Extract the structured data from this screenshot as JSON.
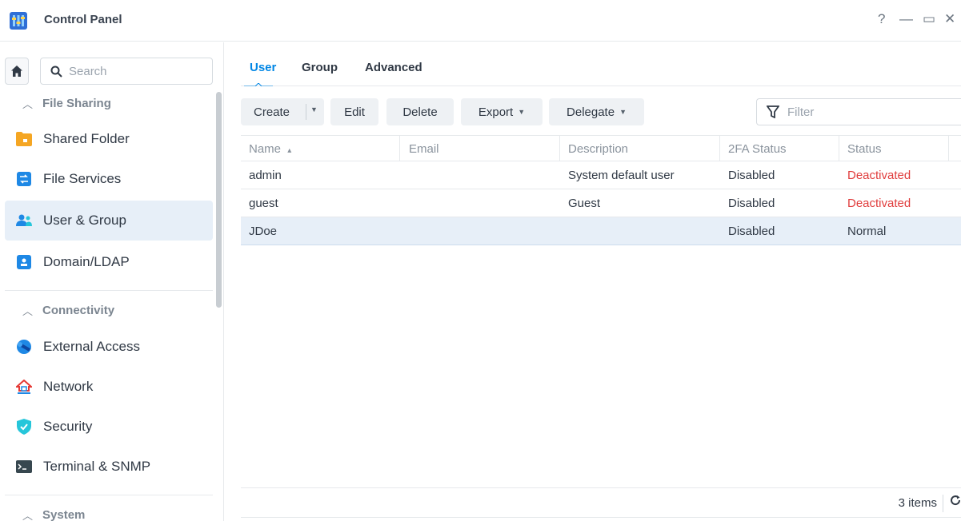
{
  "window": {
    "title": "Control Panel",
    "help_glyph": "?",
    "minimize_glyph": "—",
    "maximize_glyph": "▭",
    "close_glyph": "✕"
  },
  "sidebar": {
    "search": {
      "placeholder": "Search"
    },
    "sections": [
      {
        "label": "File Sharing",
        "items": [
          {
            "label": "Shared Folder",
            "icon": "folder-icon"
          },
          {
            "label": "File Services",
            "icon": "file-services-icon"
          },
          {
            "label": "User & Group",
            "icon": "users-icon",
            "active": true
          },
          {
            "label": "Domain/LDAP",
            "icon": "domain-icon"
          }
        ]
      },
      {
        "label": "Connectivity",
        "items": [
          {
            "label": "External Access",
            "icon": "external-access-icon"
          },
          {
            "label": "Network",
            "icon": "network-icon"
          },
          {
            "label": "Security",
            "icon": "shield-icon"
          },
          {
            "label": "Terminal & SNMP",
            "icon": "terminal-icon"
          }
        ]
      },
      {
        "label": "System",
        "items": []
      }
    ]
  },
  "tabs": [
    {
      "label": "User",
      "active": true
    },
    {
      "label": "Group"
    },
    {
      "label": "Advanced"
    }
  ],
  "toolbar": {
    "create": "Create",
    "edit": "Edit",
    "delete": "Delete",
    "export": "Export",
    "delegate": "Delegate",
    "filter_placeholder": "Filter"
  },
  "table": {
    "columns": [
      "Name",
      "Email",
      "Description",
      "2FA Status",
      "Status"
    ],
    "sort_indicator": "▴",
    "rows": [
      {
        "name": "admin",
        "email": "",
        "description": "System default user",
        "twofa": "Disabled",
        "status": "Deactivated"
      },
      {
        "name": "guest",
        "email": "",
        "description": "Guest",
        "twofa": "Disabled",
        "status": "Deactivated"
      },
      {
        "name": "JDoe",
        "email": "",
        "description": "",
        "twofa": "Disabled",
        "status": "Normal",
        "selected": true
      }
    ]
  },
  "footer": {
    "count_text": "3 items"
  },
  "colors": {
    "accent": "#0086e5",
    "deactivated": "#e03c3c",
    "selected_bg": "#e7eff8"
  }
}
